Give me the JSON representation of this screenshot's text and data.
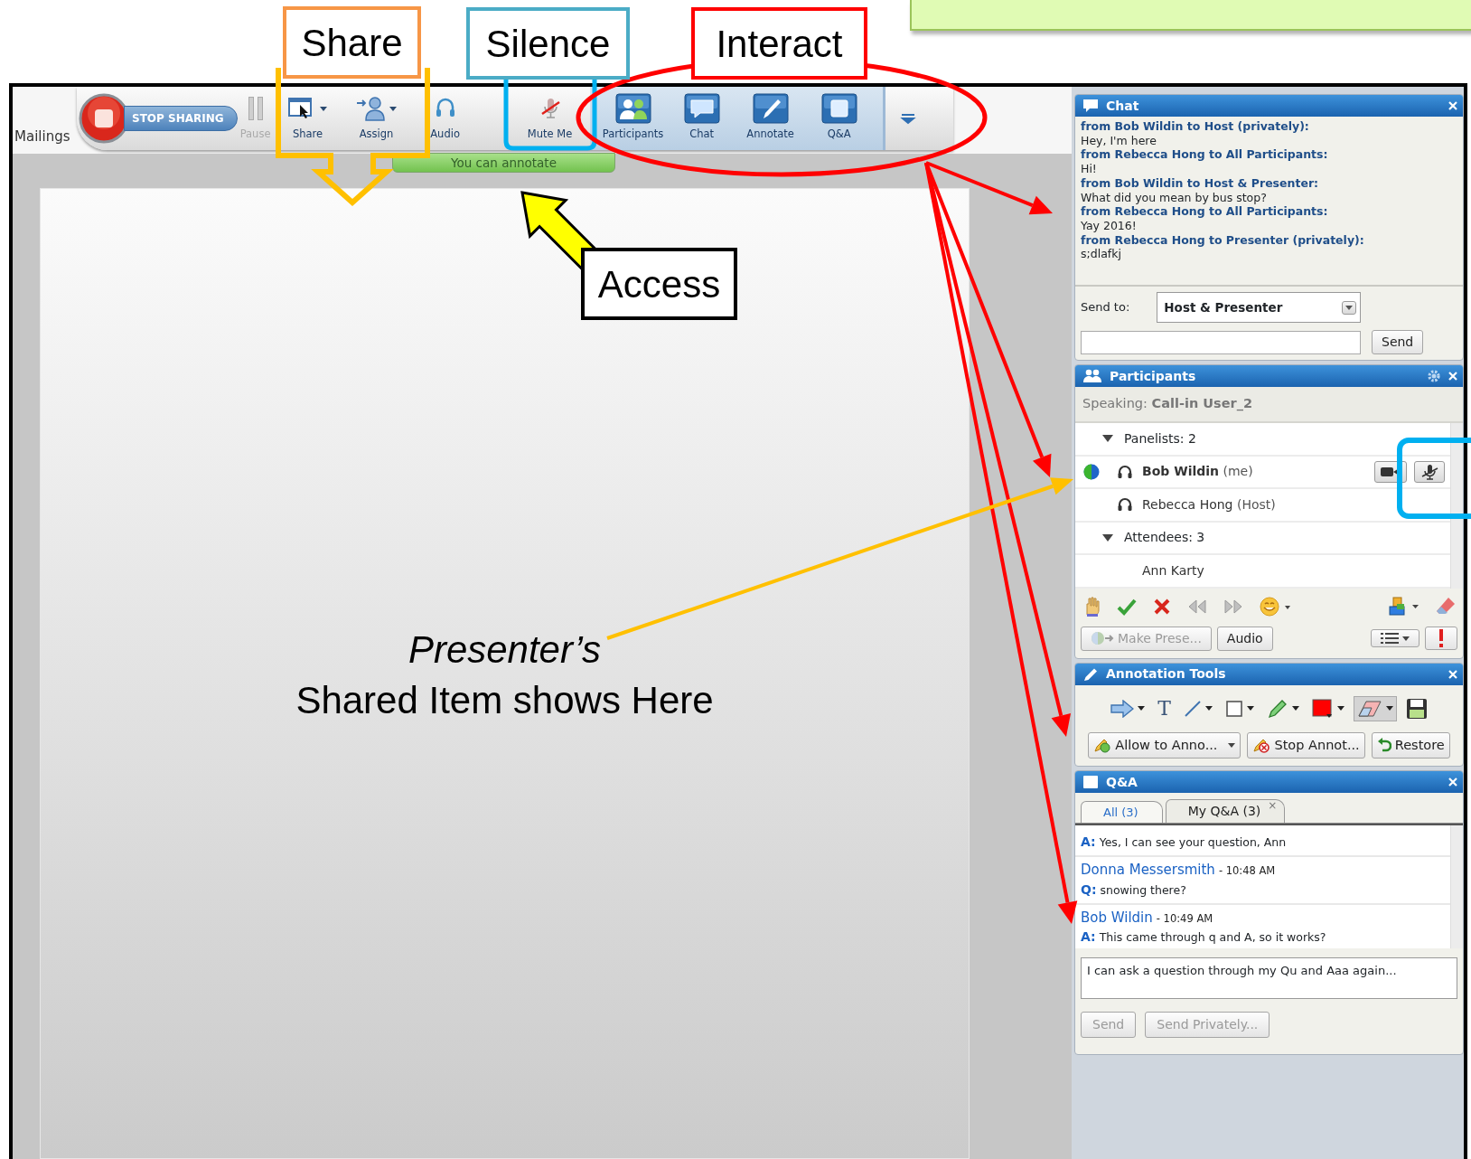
{
  "callouts": [
    {
      "label": "Share",
      "color": "#f79646"
    },
    {
      "label": "Silence",
      "color": "#4bacc6"
    },
    {
      "label": "Interact",
      "color": "#ff0000"
    },
    {
      "label": "Access",
      "color": "#000000"
    }
  ],
  "toolbar": {
    "app_tab": "Mailings",
    "stop_button": "STOP SHARING",
    "buttons": [
      {
        "label": "Pause",
        "disabled": true,
        "dropdown": false
      },
      {
        "label": "Share",
        "disabled": false,
        "dropdown": true
      },
      {
        "label": "Assign",
        "disabled": false,
        "dropdown": true
      },
      {
        "label": "Audio",
        "disabled": false,
        "dropdown": false
      },
      {
        "label": "Mute Me",
        "disabled": false,
        "dropdown": false
      }
    ],
    "panel_buttons": [
      {
        "label": "Participants"
      },
      {
        "label": "Chat"
      },
      {
        "label": "Annotate"
      },
      {
        "label": "Q&A"
      }
    ],
    "notice": "You can annotate"
  },
  "shared_area": {
    "title": "Presenter’s",
    "subtitle": "Shared Item shows Here"
  },
  "chat": {
    "title": "Chat",
    "messages": [
      {
        "from": "from Bob Wildin to Host (privately):",
        "text": "Hey, I'm here"
      },
      {
        "from": "from Rebecca Hong to All Participants:",
        "text": "Hi!"
      },
      {
        "from": "from Bob Wildin to Host & Presenter:",
        "text": "What did you mean by bus stop?"
      },
      {
        "from": "from Rebecca Hong to All Participants:",
        "text": "Yay 2016!"
      },
      {
        "from": "from Rebecca Hong to Presenter (privately):",
        "text": "s;dlafkj"
      }
    ],
    "send_to_label": "Send to:",
    "send_to_value": "Host & Presenter",
    "send_button": "Send"
  },
  "participants": {
    "title": "Participants",
    "speaking": "Speaking: **Call-in User_2**",
    "groups": [
      {
        "label": "Panelists: 2",
        "expanded": true,
        "children": [
          {
            "name": "Bob Wildin",
            "note": "(me)",
            "current_user": true,
            "presenter": true,
            "audio": true,
            "controls": true
          },
          {
            "name": "Rebecca Hong",
            "note": "(Host)",
            "current_user": false,
            "presenter": false,
            "audio": true,
            "controls": false
          }
        ]
      },
      {
        "label": "Attendees: 3",
        "expanded": true,
        "children": [
          {
            "name": "Ann Karty",
            "current_user": false,
            "presenter": false,
            "audio": false,
            "controls": false
          }
        ]
      }
    ],
    "buttons": [
      {
        "label": "Make Prese...",
        "disabled": true
      },
      {
        "label": "Audio",
        "disabled": false
      }
    ]
  },
  "annotation_tools": {
    "title": "Annotation Tools",
    "tools": [
      {
        "kind": "arrow",
        "dropdown": true,
        "selected": false
      },
      {
        "kind": "text",
        "glyph": "T",
        "dropdown": false,
        "selected": false
      },
      {
        "kind": "line",
        "dropdown": true,
        "selected": false
      },
      {
        "kind": "rect",
        "dropdown": true,
        "selected": false
      },
      {
        "kind": "pen",
        "dropdown": true,
        "selected": false
      },
      {
        "kind": "color",
        "dropdown": true,
        "selected": false
      },
      {
        "kind": "eraser",
        "dropdown": true,
        "selected": true
      },
      {
        "kind": "save",
        "dropdown": false,
        "selected": false
      }
    ],
    "buttons": [
      {
        "label": "Allow to Anno...",
        "dropdown": true
      },
      {
        "label": "Stop Annot...",
        "dropdown": false
      },
      {
        "label": "Restore",
        "dropdown": false
      }
    ]
  },
  "qa": {
    "title": "Q&A",
    "tabs": [
      {
        "label": "All (3)",
        "selected": true
      },
      {
        "label": "My Q&A (3)",
        "selected": false,
        "close": "×"
      }
    ],
    "entries": [
      {
        "prefix": "A:",
        "text": "Yes, I can see your question, Ann"
      },
      {
        "author": "Donna Messersmith",
        "time": "- 10:48 AM",
        "prefix": "Q:",
        "text": "snowing there?"
      },
      {
        "author": "Bob Wildin",
        "time": "- 10:49 AM",
        "prefix": "A:",
        "text": "This came through q and A, so it works?"
      }
    ],
    "draft": "I can ask a question through my Qu and Aaa again...",
    "buttons": [
      {
        "label": "Send",
        "disabled": true
      },
      {
        "label": "Send Privately...",
        "disabled": true
      }
    ]
  }
}
